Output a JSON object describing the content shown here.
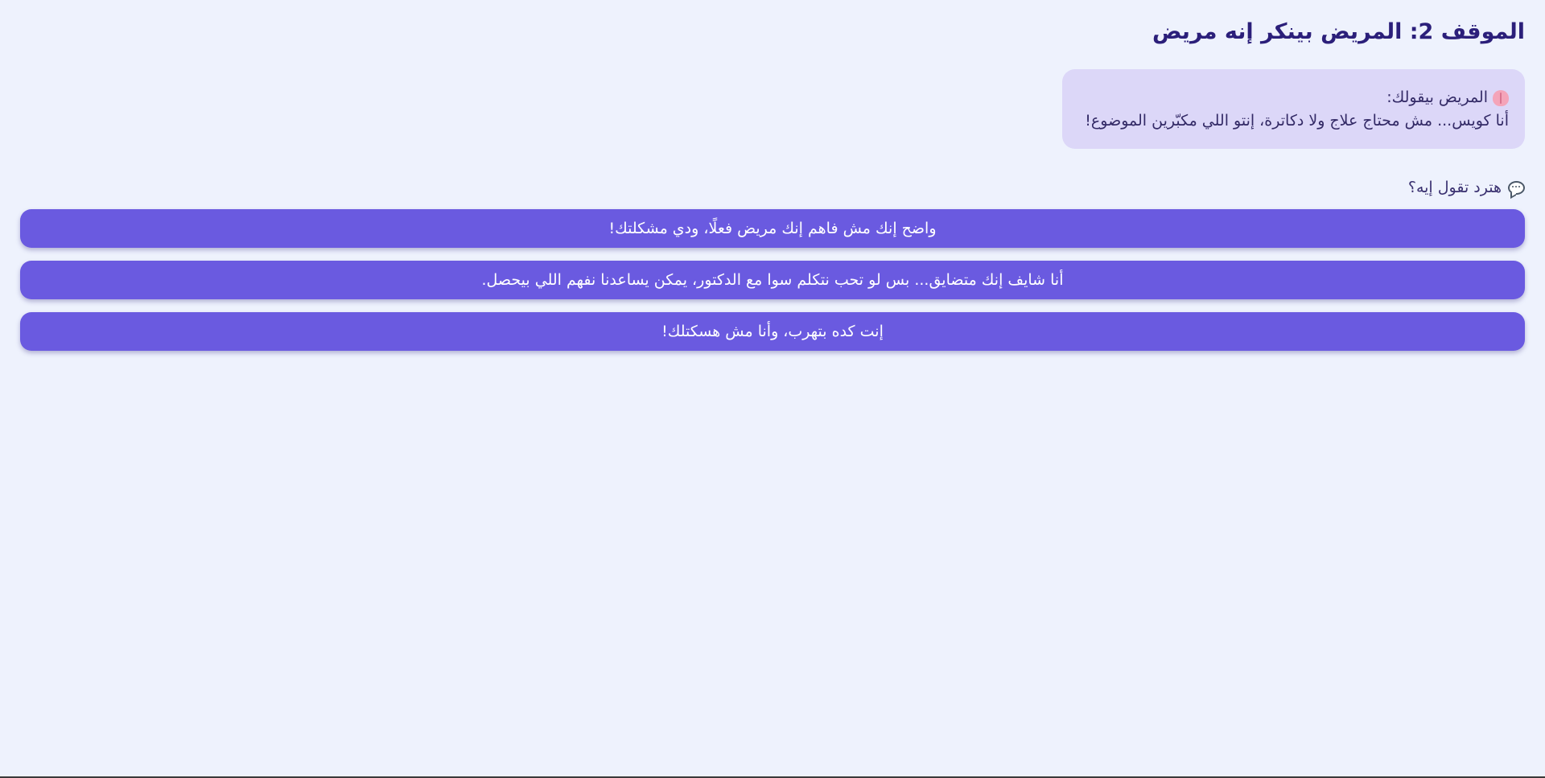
{
  "scenario": {
    "title": "الموقف 2: المريض بينكر إنه مريض"
  },
  "patient": {
    "icon": "brain-icon",
    "label": "المريض بيقولك:",
    "statement": "أنا كويس... مش محتاج علاج ولا دكاترة، إنتو اللي مكبّرين الموضوع!"
  },
  "question": {
    "icon": "speech-bubble-icon",
    "text": "هترد تقول إيه؟"
  },
  "options": [
    {
      "label": "واضح إنك مش فاهم إنك مريض فعلًا، ودي مشكلتك!"
    },
    {
      "label": "أنا شايف إنك متضايق... بس لو تحب نتكلم سوا مع الدكتور، يمكن يساعدنا نفهم اللي بيحصل."
    },
    {
      "label": "إنت كده بتهرب، وأنا مش هسكتلك!"
    }
  ],
  "colors": {
    "background": "#eef2fd",
    "card": "#dcd7f8",
    "button": "#6a5ae0",
    "title": "#2b1f7a"
  }
}
